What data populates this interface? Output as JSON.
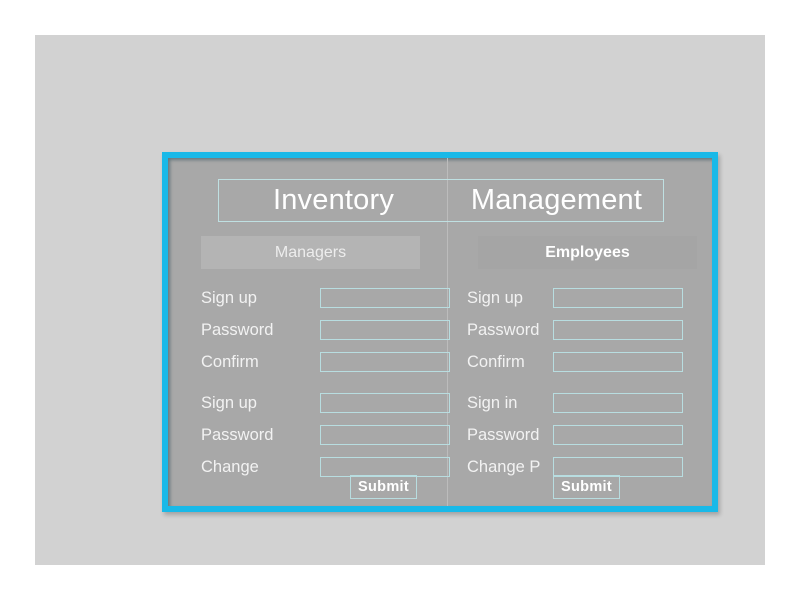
{
  "page": {
    "background_color": "#ffffff",
    "panel_color": "#d2d2d2"
  },
  "form_window": {
    "frame_color": "#19b9e8",
    "background_color": "#a8a8a8",
    "accent_border_color": "#b8dde0"
  },
  "title": {
    "left": "Inventory",
    "right": "Management"
  },
  "columns": [
    {
      "id": "managers",
      "header": "Managers",
      "header_background": "#b4b4b4",
      "groups": [
        {
          "rows": [
            {
              "label": "Sign up",
              "value": "",
              "placeholder": ""
            },
            {
              "label": "Password",
              "value": "",
              "placeholder": ""
            },
            {
              "label": "Confirm",
              "value": "",
              "placeholder": ""
            }
          ]
        },
        {
          "rows": [
            {
              "label": "Sign up",
              "value": "",
              "placeholder": ""
            },
            {
              "label": "Password",
              "value": "",
              "placeholder": ""
            },
            {
              "label": "Change",
              "value": "",
              "placeholder": ""
            }
          ]
        }
      ],
      "submit_label": "Submit"
    },
    {
      "id": "employees",
      "header": "Employees",
      "header_background": "#a5a5a5",
      "groups": [
        {
          "rows": [
            {
              "label": "Sign up",
              "value": "",
              "placeholder": ""
            },
            {
              "label": "Password",
              "value": "",
              "placeholder": ""
            },
            {
              "label": "Confirm",
              "value": "",
              "placeholder": ""
            }
          ]
        },
        {
          "rows": [
            {
              "label": "Sign in",
              "value": "",
              "placeholder": ""
            },
            {
              "label": "Password",
              "value": "",
              "placeholder": ""
            },
            {
              "label": "Change P",
              "value": "",
              "placeholder": ""
            }
          ]
        }
      ],
      "submit_label": "Submit"
    }
  ]
}
